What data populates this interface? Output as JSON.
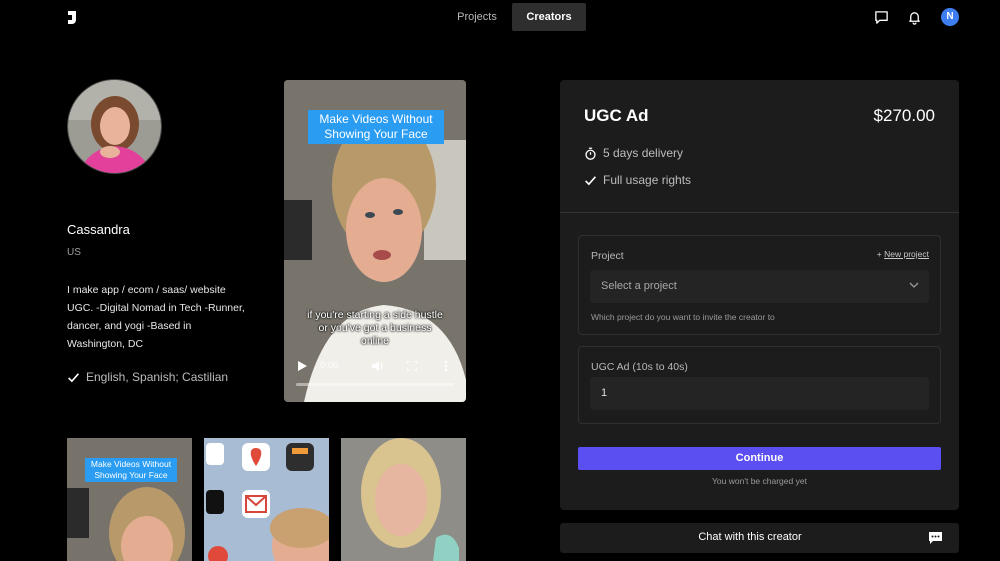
{
  "nav": {
    "tabs": [
      {
        "label": "Projects",
        "active": false
      },
      {
        "label": "Creators",
        "active": true
      }
    ],
    "icons": [
      "chat-bubble-icon",
      "bell-icon"
    ],
    "avatar_initial": "N",
    "avatar_color": "#3f7ef2"
  },
  "profile": {
    "name": "Cassandra",
    "country": "US",
    "bio": "I make app / ecom / saas/ website UGC. -Digital Nomad in Tech -Runner, dancer, and yogi -Based in Washington, DC",
    "languages": "English, Spanish; Castilian"
  },
  "video": {
    "title_overlay": "Make Videos Without Showing Your Face",
    "caption": "if you're starting a side hustle or you've got a business online",
    "time": "0:00"
  },
  "thumbnails": [
    {
      "title_overlay": "Make Videos Without Showing Your Face"
    },
    {
      "title_overlay": ""
    },
    {
      "title_overlay": ""
    }
  ],
  "offer": {
    "title": "UGC Ad",
    "price": "$270.00",
    "features": [
      "5 days delivery",
      "Full usage rights"
    ],
    "project_field": {
      "label": "Project",
      "new_project_label": "New project",
      "placeholder": "Select a project",
      "help": "Which project do you want to invite the creator to"
    },
    "quantity_field": {
      "label": "UGC Ad (10s to 40s)",
      "value": "1"
    },
    "continue_label": "Continue",
    "charge_note": "You won't be charged yet",
    "accent_color": "#5b4ff2"
  },
  "chat": {
    "label": "Chat with this creator"
  }
}
